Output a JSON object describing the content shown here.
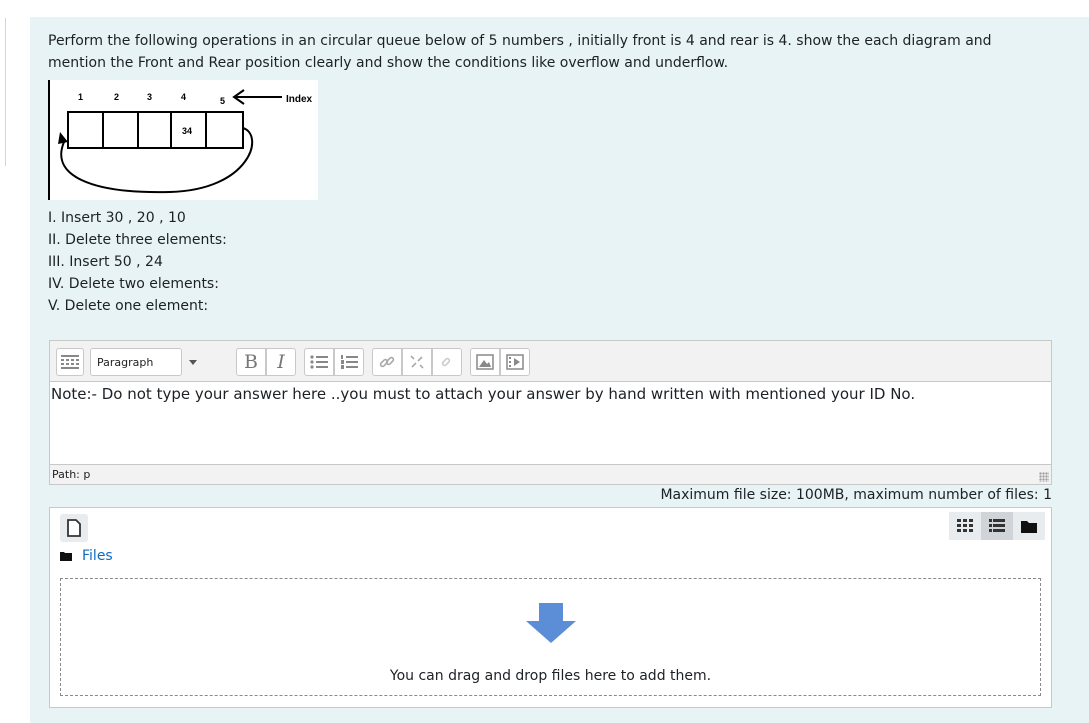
{
  "question": {
    "text": "Perform the following operations in an circular queue below of 5 numbers , initially front is 4 and rear is 4. show the each diagram and mention the Front and Rear position clearly and show the conditions like overflow and underflow.",
    "diagram": {
      "indices": [
        "1",
        "2",
        "3",
        "4",
        "5"
      ],
      "cell_value": "34",
      "index_label": "Index"
    },
    "operations": [
      "I.  Insert 30 , 20 , 10",
      "II.  Delete three elements:",
      "III.  Insert 50 , 24",
      "IV. Delete two elements:",
      "V. Delete one element:"
    ]
  },
  "editor": {
    "format_select": "Paragraph",
    "toolbar_icons": [
      "toolbar-toggle-icon",
      "bold-icon",
      "italic-icon",
      "unordered-list-icon",
      "ordered-list-icon",
      "link-icon",
      "unlink-icon",
      "anchor-icon",
      "image-icon",
      "media-icon"
    ],
    "bold_glyph": "B",
    "italic_glyph": "I",
    "content": "Note:- Do not type your answer here ..you must to attach your answer by hand written with mentioned your ID No.",
    "path": "Path: p"
  },
  "file_limits": "Maximum file size: 100MB, maximum number of files: 1",
  "filemanager": {
    "folder_label": "Files",
    "drop_text": "You can drag and drop files here to add them.",
    "views": [
      "grid-view-icon",
      "list-view-icon",
      "tree-view-icon"
    ],
    "accent": "#0f6cbf",
    "arrow_color": "#5b8ed6"
  },
  "colors": {
    "panel_bg": "#e7f3f5",
    "link": "#0f6cbf"
  }
}
